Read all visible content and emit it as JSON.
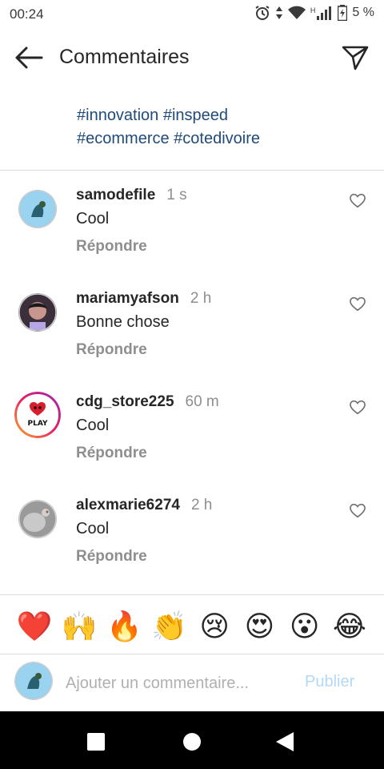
{
  "status_bar": {
    "time": "00:24",
    "network_type": "H",
    "battery": "5 %"
  },
  "header": {
    "title": "Commentaires",
    "icons": [
      "back-arrow-icon",
      "send-icon"
    ]
  },
  "caption": {
    "line1": "#innovation #inspeed",
    "line2": "#ecommerce #cotedivoire",
    "link_color": "#1f4a7a"
  },
  "comments": [
    {
      "user": "samodefile",
      "time": "1 s",
      "text": "Cool",
      "reply": "Répondre"
    },
    {
      "user": "mariamyafson",
      "time": "2 h",
      "text": "Bonne chose",
      "reply": "Répondre"
    },
    {
      "user": "cdg_store225",
      "time": "60 m",
      "text": "Cool",
      "reply": "Répondre"
    },
    {
      "user": "alexmarie6274",
      "time": "2 h",
      "text": "Cool",
      "reply": "Répondre"
    }
  ],
  "emojis": [
    "❤️",
    "🙌",
    "🔥",
    "👏",
    "😢",
    "😍",
    "😮",
    "😂"
  ],
  "composer": {
    "placeholder": "Ajouter un commentaire...",
    "publish_label": "Publier",
    "publish_color": "#b3d8f7"
  },
  "nav": {
    "icons": [
      "recent-apps-icon",
      "home-icon",
      "back-icon"
    ]
  }
}
